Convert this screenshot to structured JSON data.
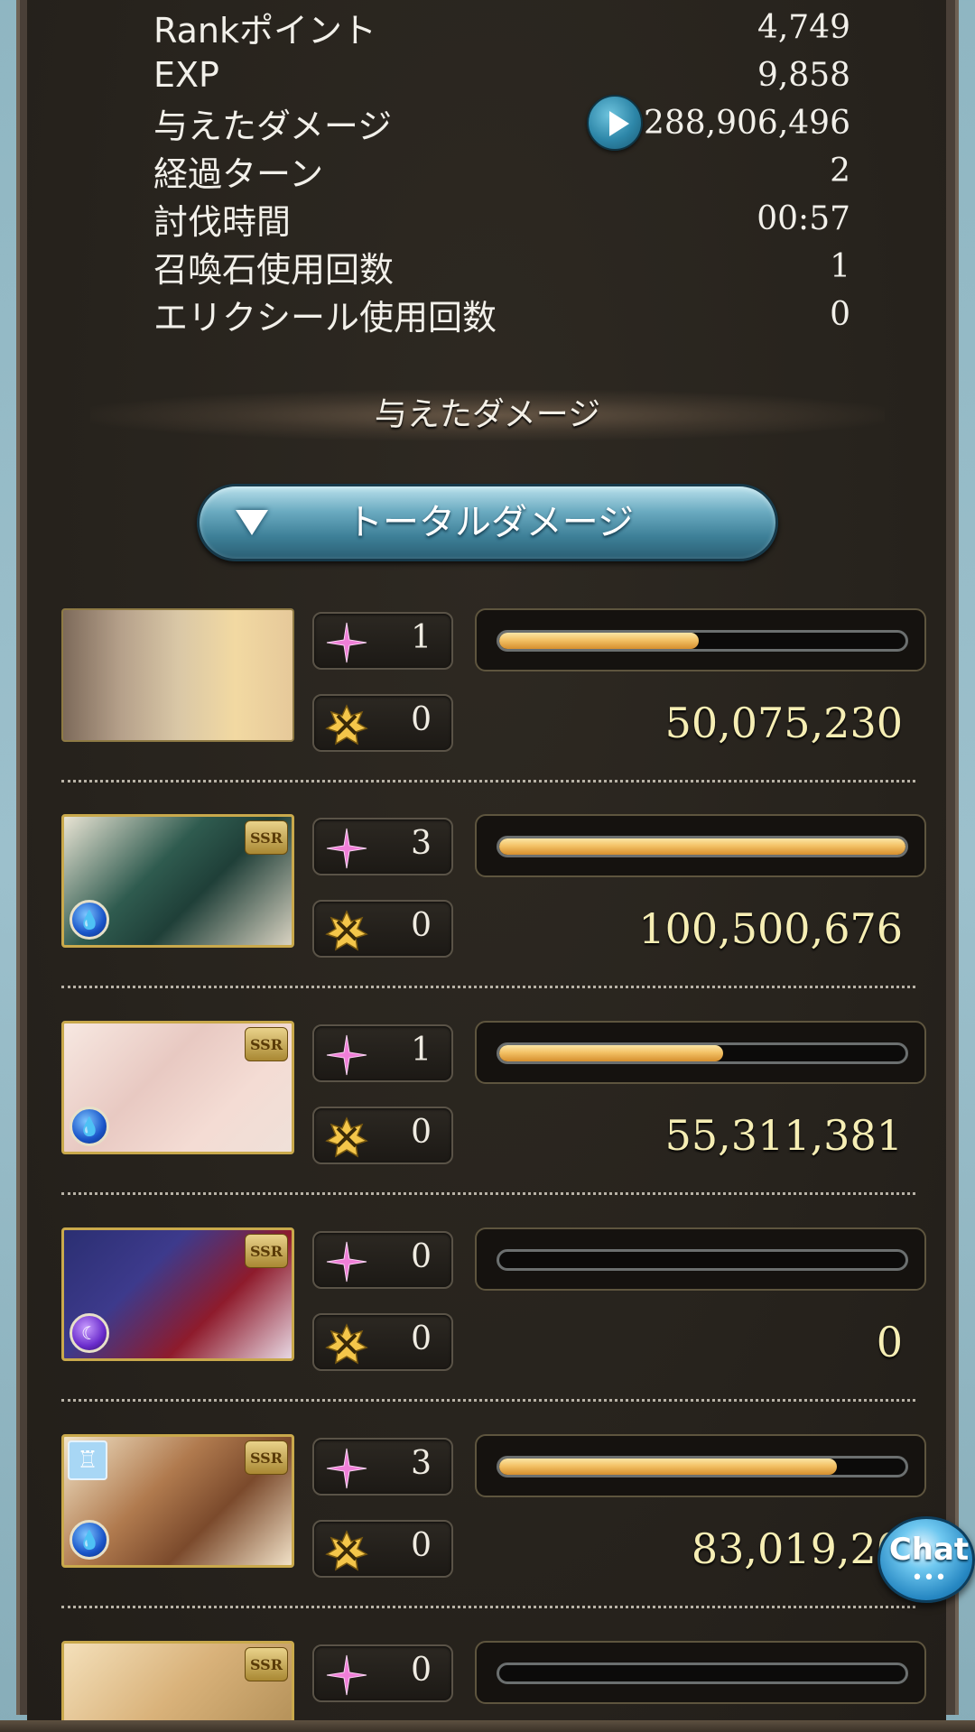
{
  "stats": [
    {
      "label": "Rankポイント",
      "value": "4,749"
    },
    {
      "label": "EXP",
      "value": "9,858"
    },
    {
      "label": "与えたダメージ",
      "value": "288,906,496"
    },
    {
      "label": "経過ターン",
      "value": "2"
    },
    {
      "label": "討伐時間",
      "value": "00:57"
    },
    {
      "label": "召喚石使用回数",
      "value": "1"
    },
    {
      "label": "エリクシール使用回数",
      "value": "0"
    }
  ],
  "section_title": "与えたダメージ",
  "dropdown": {
    "label": "トータルダメージ",
    "icon": "triangle-down-icon"
  },
  "characters": [
    {
      "name": "party-main-characters",
      "ssr": "",
      "element": "",
      "special_count": "1",
      "ca_count": "0",
      "damage": "50,075,230",
      "bar_fraction": 0.49
    },
    {
      "name": "character-2",
      "ssr": "SSR",
      "element": "water",
      "special_count": "3",
      "ca_count": "0",
      "damage": "100,500,676",
      "bar_fraction": 1.0
    },
    {
      "name": "character-3",
      "ssr": "SSR",
      "element": "water",
      "special_count": "1",
      "ca_count": "0",
      "damage": "55,311,381",
      "bar_fraction": 0.55
    },
    {
      "name": "character-4",
      "ssr": "SSR",
      "element": "dark",
      "special_count": "0",
      "ca_count": "0",
      "damage": "0",
      "bar_fraction": 0.0
    },
    {
      "name": "character-5",
      "ssr": "SSR",
      "element": "water",
      "special_count": "3",
      "ca_count": "0",
      "damage": "83,019,20",
      "bar_fraction": 0.83
    },
    {
      "name": "character-6",
      "ssr": "SSR",
      "element": "",
      "special_count": "0",
      "ca_count": "",
      "damage": "",
      "bar_fraction": 0.0
    }
  ],
  "chat": {
    "label": "Chat",
    "dots": "•••"
  },
  "colors": {
    "bar_fill": "#f3c266",
    "damage_text": "#f6eeb4",
    "panel_bg": "#27231d",
    "button_blue": "#3d7f97"
  }
}
